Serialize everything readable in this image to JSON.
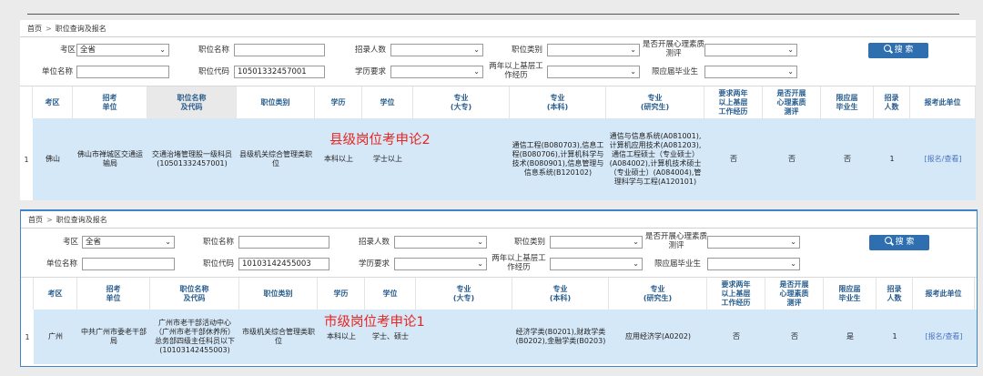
{
  "panels": [
    {
      "breadcrumb": {
        "home": "首页",
        "current": "职位查询及报名"
      },
      "filters": {
        "kaoqu_label": "考区",
        "kaoqu_value": "全省",
        "zwmc_label": "职位名称",
        "zwmc_value": "",
        "zlrs_label": "招录人数",
        "zlrs_value": "",
        "zwlb_label": "职位类别",
        "zwlb_value": "",
        "xlcp_label": "是否开展心理素质测评",
        "xlcp_value": "",
        "dwmc_label": "单位名称",
        "dwmc_value": "",
        "zwdm_label": "职位代码",
        "zwdm_value": "10501332457001",
        "xlyq_label": "学历要求",
        "xlyq_value": "",
        "jcjl_label": "两年以上基层工作经历",
        "jcjl_value": "",
        "xyj_label": "限应届毕业生",
        "xyj_value": ""
      },
      "search_label": "搜 索",
      "headers": [
        "考区",
        "招考\n单位",
        "职位名称\n及代码",
        "职位类别",
        "学历",
        "学位",
        "专业\n(大专)",
        "专业\n(本科)",
        "专业\n(研究生)",
        "要求两年\n以上基层\n工作经历",
        "是否开展\n心理素质\n测评",
        "限应届\n毕业生",
        "招录\n人数",
        "报考此单位"
      ],
      "row": {
        "num": "1",
        "kaoqu": "佛山",
        "danwei": "佛山市禅城区交通运输局",
        "zhiwei": "交通治堵管理股一级科员 (10501332457001)",
        "leibie": "县级机关综合管理类职位",
        "xueli": "本科以上",
        "xuewei": "学士以上",
        "dazhuan": "",
        "benke": "通信工程(B080703),信息工程(B080706),计算机科学与技术(B080901),信息管理与信息系统(B120102)",
        "yanjiusheng": "通信与信息系统(A081001),计算机应用技术(A081203),通信工程硕士（专业硕士）(A084002),计算机技术硕士（专业硕士）(A084004),管理科学与工程(A120101)",
        "jiceng": "否",
        "xinli": "否",
        "yingjie": "否",
        "renshu": "1",
        "action": "[报名/查看]"
      },
      "annotation": "县级岗位考申论2"
    },
    {
      "breadcrumb": {
        "home": "首页",
        "current": "职位查询及报名"
      },
      "filters": {
        "kaoqu_label": "考区",
        "kaoqu_value": "全省",
        "zwmc_label": "职位名称",
        "zwmc_value": "",
        "zlrs_label": "招录人数",
        "zlrs_value": "",
        "zwlb_label": "职位类别",
        "zwlb_value": "",
        "xlcp_label": "是否开展心理素质测评",
        "xlcp_value": "",
        "dwmc_label": "单位名称",
        "dwmc_value": "",
        "zwdm_label": "职位代码",
        "zwdm_value": "10103142455003",
        "xlyq_label": "学历要求",
        "xlyq_value": "",
        "jcjl_label": "两年以上基层工作经历",
        "jcjl_value": "",
        "xyj_label": "限应届毕业生",
        "xyj_value": ""
      },
      "search_label": "搜 索",
      "headers": [
        "考区",
        "招考\n单位",
        "职位名称\n及代码",
        "职位类别",
        "学历",
        "学位",
        "专业\n(大专)",
        "专业\n(本科)",
        "专业\n(研究生)",
        "要求两年\n以上基层\n工作经历",
        "是否开展\n心理素质\n测评",
        "限应届\n毕业生",
        "招录\n人数",
        "报考此单位"
      ],
      "row": {
        "num": "1",
        "kaoqu": "广州",
        "danwei": "中共广州市委老干部局",
        "zhiwei": "广州市老干部活动中心（广州市老干部休养所）总务部四级主任科员以下 (10103142455003)",
        "leibie": "市级机关综合管理类职位",
        "xueli": "本科以上",
        "xuewei": "学士、硕士",
        "dazhuan": "",
        "benke": "经济学类(B0201),财政学类(B0202),金融学类(B0203)",
        "yanjiusheng": "应用经济学(A0202)",
        "jiceng": "否",
        "xinli": "否",
        "yingjie": "是",
        "renshu": "1",
        "action": "[报名/查看]"
      },
      "annotation": "市级岗位考申论1"
    }
  ]
}
